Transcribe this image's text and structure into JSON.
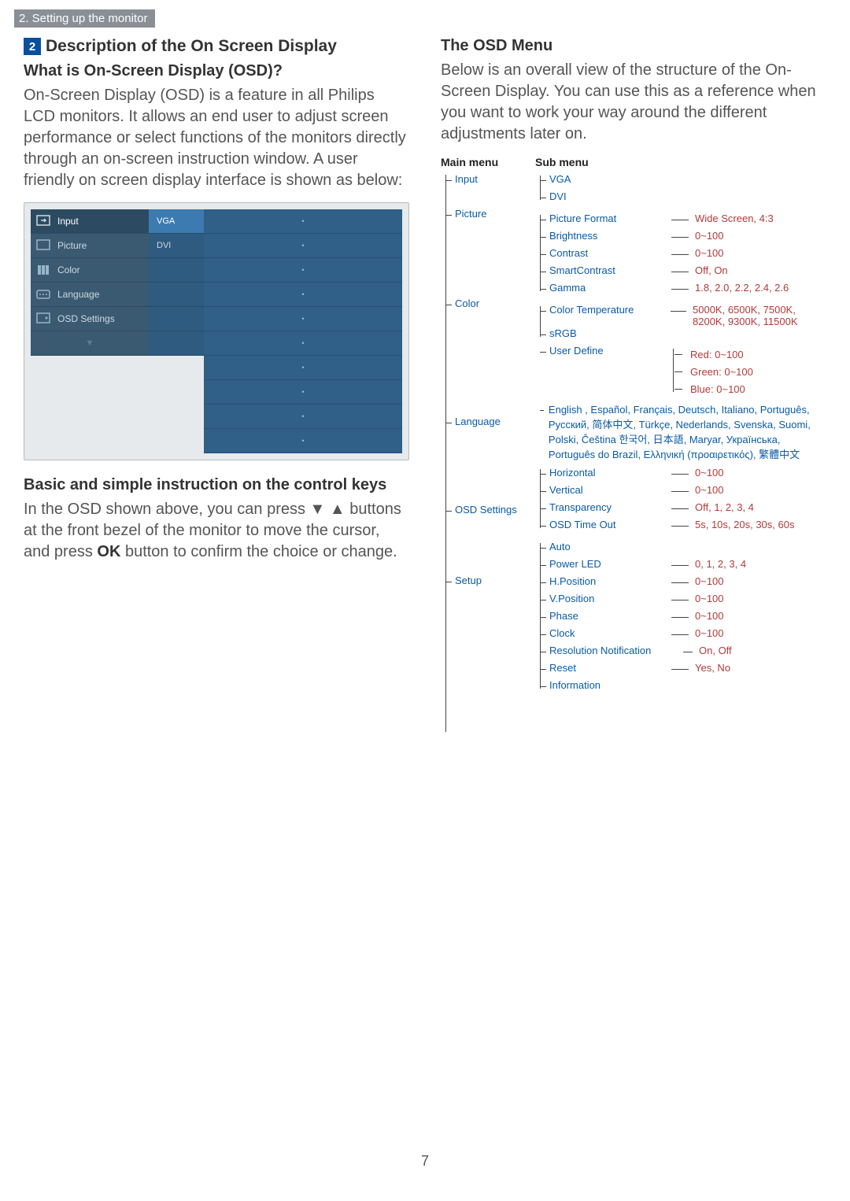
{
  "chapter": "2. Setting up the monitor",
  "page_number": "7",
  "left": {
    "section_badge": "2",
    "section_title": "Description of the On Screen Display",
    "sub1_title": "What is On-Screen Display (OSD)?",
    "sub1_body": "On-Screen Display (OSD) is a feature in all Philips LCD monitors. It allows an end user to adjust screen performance or select functions of the monitors directly through an on-screen instruction window. A user friendly on screen display interface is shown as below:",
    "osd": {
      "items": [
        "Input",
        "Picture",
        "Color",
        "Language",
        "OSD Settings"
      ],
      "mid": [
        "VGA",
        "DVI"
      ],
      "down": "▼"
    },
    "sub2_title": "Basic and simple instruction on the control keys",
    "sub2_body_a": "In the OSD shown above, you can press ▼ ▲ buttons at the front bezel of the monitor to move the cursor, and press ",
    "sub2_body_ok": "OK",
    "sub2_body_b": " button to confirm the choice or change."
  },
  "right": {
    "title": "The OSD Menu",
    "intro": "Below is an overall view of the structure of the On-Screen Display. You can use this as a reference when you want to work your way around the different adjustments later on.",
    "headers": {
      "main": "Main menu",
      "sub": "Sub menu"
    },
    "menu": {
      "input": {
        "label": "Input",
        "items": [
          {
            "n": "VGA"
          },
          {
            "n": "DVI"
          }
        ]
      },
      "picture": {
        "label": "Picture",
        "items": [
          {
            "n": "Picture Format",
            "v": "Wide Screen, 4:3"
          },
          {
            "n": "Brightness",
            "v": "0~100"
          },
          {
            "n": "Contrast",
            "v": "0~100"
          },
          {
            "n": "SmartContrast",
            "v": "Off, On"
          },
          {
            "n": "Gamma",
            "v": "1.8, 2.0, 2.2, 2.4, 2.6"
          }
        ]
      },
      "color": {
        "label": "Color",
        "items": [
          {
            "n": "Color Temperature",
            "v": "5000K, 6500K, 7500K, 8200K, 9300K, 11500K"
          },
          {
            "n": "sRGB"
          },
          {
            "n": "User Define",
            "sub": [
              "Red: 0~100",
              "Green: 0~100",
              "Blue: 0~100"
            ]
          }
        ]
      },
      "language": {
        "label": "Language",
        "text": "English , Español, Français, Deutsch, Italiano, Português, Русский, 简体中文, Türkçe, Nederlands, Svenska, Suomi, Polski, Čeština 한국어, 日本語, Maryar, Українська, Português do Brazil, Ελληνική (προαιρετικός), 繁體中文"
      },
      "osd_settings": {
        "label": "OSD Settings",
        "items": [
          {
            "n": "Horizontal",
            "v": "0~100"
          },
          {
            "n": "Vertical",
            "v": "0~100"
          },
          {
            "n": "Transparency",
            "v": "Off, 1, 2, 3, 4"
          },
          {
            "n": "OSD Time Out",
            "v": "5s, 10s, 20s, 30s, 60s"
          }
        ]
      },
      "setup": {
        "label": "Setup",
        "items": [
          {
            "n": "Auto"
          },
          {
            "n": "Power LED",
            "v": "0, 1, 2, 3, 4"
          },
          {
            "n": "H.Position",
            "v": "0~100"
          },
          {
            "n": "V.Position",
            "v": "0~100"
          },
          {
            "n": "Phase",
            "v": "0~100"
          },
          {
            "n": "Clock",
            "v": "0~100"
          },
          {
            "n": "Resolution Notification",
            "v": "On, Off"
          },
          {
            "n": "Reset",
            "v": "Yes, No"
          },
          {
            "n": "Information"
          }
        ]
      }
    }
  }
}
